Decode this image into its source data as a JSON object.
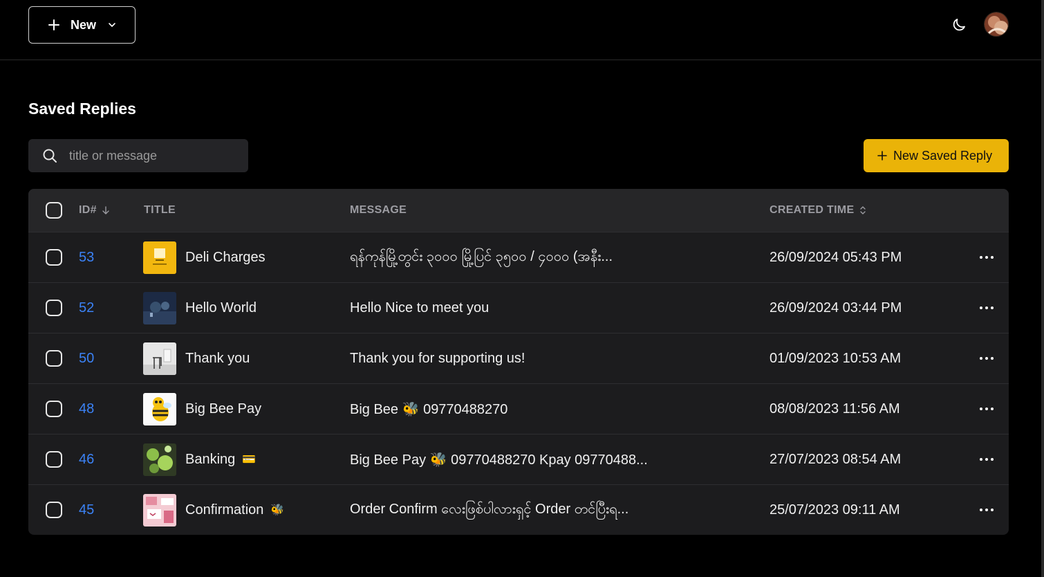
{
  "header": {
    "new_label": "New",
    "theme_icon": "moon-icon",
    "avatar_icon": "user-avatar"
  },
  "page": {
    "title": "Saved Replies"
  },
  "search": {
    "placeholder": "title or message",
    "value": ""
  },
  "actions": {
    "new_saved_reply_label": "New Saved Reply"
  },
  "colors": {
    "accent": "#eab308",
    "link": "#3b82f6",
    "background": "#000000",
    "table_bg": "#1c1c1e"
  },
  "table": {
    "columns": {
      "id": "ID#",
      "title": "TITLE",
      "message": "MESSAGE",
      "created": "CREATED TIME"
    },
    "rows": [
      {
        "id": "53",
        "title": "Deli Charges",
        "title_emoji": "",
        "message": "ရန်ကုန်မြို့တွင်း ၃၀၀၀ မြို့ပြင် ၃၅၀၀ / ၄၀၀၀ (အနီး...",
        "created": "26/09/2024 05:43 PM",
        "thumb": "yellow-card"
      },
      {
        "id": "52",
        "title": "Hello World",
        "title_emoji": "",
        "message": "Hello Nice to meet you",
        "created": "26/09/2024 03:44 PM",
        "thumb": "night-landscape"
      },
      {
        "id": "50",
        "title": "Thank you",
        "title_emoji": "",
        "message": "Thank you for supporting us!",
        "created": "01/09/2023 10:53 AM",
        "thumb": "white-chair"
      },
      {
        "id": "48",
        "title": "Big Bee Pay",
        "title_emoji": "",
        "message": "Big Bee 🐝 09770488270",
        "created": "08/08/2023 11:56 AM",
        "thumb": "bee-cartoon"
      },
      {
        "id": "46",
        "title": "Banking",
        "title_emoji": "💳",
        "message": "Big Bee Pay 🐝 09770488270 Kpay 09770488...",
        "created": "27/07/2023 08:54 AM",
        "thumb": "green-leaves"
      },
      {
        "id": "45",
        "title": "Confirmation",
        "title_emoji": "🐝",
        "message": "Order Confirm လေးဖြစ်ပါလားရှင့် Order တင်ပြီးရ...",
        "created": "25/07/2023 09:11 AM",
        "thumb": "pink-collage"
      }
    ]
  }
}
